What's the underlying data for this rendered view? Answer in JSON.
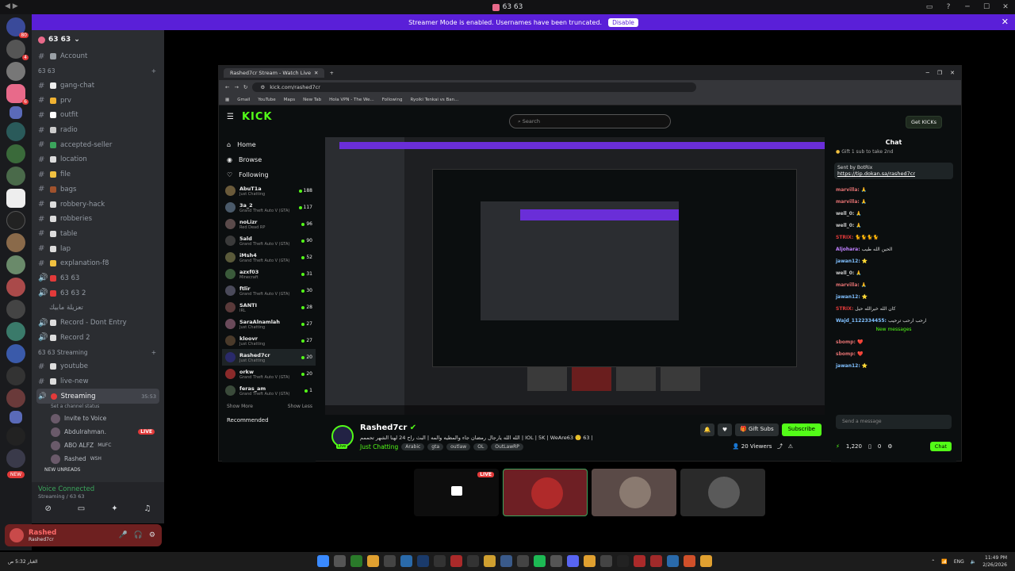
{
  "window": {
    "title": "63 63"
  },
  "banner": {
    "text": "Streamer Mode is enabled. Usernames have been truncated.",
    "button": "Disable"
  },
  "rail": {
    "badges": [
      "80",
      "4",
      "6"
    ],
    "new_label": "NEW"
  },
  "guild": {
    "name": "63 63"
  },
  "channels_top": [
    {
      "name": "Account",
      "type": "text",
      "emoji_color": "#9aa0a6"
    },
    {
      "category": "63 63"
    },
    {
      "name": "gang-chat",
      "type": "text",
      "emoji_color": "#eeeeee"
    },
    {
      "name": "prv",
      "type": "text",
      "emoji_color": "#f0b232"
    },
    {
      "name": "outfit",
      "type": "text",
      "emoji_color": "#ffffff"
    },
    {
      "name": "radio",
      "type": "text",
      "emoji_color": "#cccccc"
    },
    {
      "name": "accepted-seller",
      "type": "text",
      "emoji_color": "#3ba55c"
    },
    {
      "name": "location",
      "type": "text",
      "emoji_color": "#dddddd"
    },
    {
      "name": "file",
      "type": "text",
      "emoji_color": "#f0c040"
    },
    {
      "name": "bags",
      "type": "text",
      "emoji_color": "#a0522d"
    },
    {
      "name": "robbery-hack",
      "type": "text",
      "emoji_color": "#dddddd"
    },
    {
      "name": "robberies",
      "type": "text",
      "emoji_color": "#dddddd"
    },
    {
      "name": "table",
      "type": "text",
      "emoji_color": "#dddddd"
    },
    {
      "name": "lap",
      "type": "text",
      "emoji_color": "#dddddd"
    },
    {
      "name": "explanation-f8",
      "type": "text",
      "emoji_color": "#f0c040"
    },
    {
      "name": "63 63",
      "type": "voice",
      "emoji_color": "#e23a3a"
    },
    {
      "name": "63 63 2",
      "type": "voice",
      "emoji_color": "#e23a3a"
    },
    {
      "name": "تعزيلة مابيك",
      "type": "text-plain"
    },
    {
      "name": "Record - Dont Entry",
      "type": "voice",
      "emoji_color": "#dddddd"
    },
    {
      "name": "Record 2",
      "type": "voice",
      "emoji_color": "#dddddd"
    },
    {
      "category": "63 63 Streaming"
    },
    {
      "name": "youtube",
      "type": "text",
      "emoji_color": "#dddddd"
    },
    {
      "name": "live-new",
      "type": "text",
      "emoji_color": "#dddddd"
    }
  ],
  "active_channel": {
    "name": "Streaming",
    "time": "35:53",
    "status": "Set a channel status"
  },
  "voice_users": [
    {
      "name": "Invite to Voice",
      "live": ""
    },
    {
      "name": "Abdulrahman.",
      "live": "LIVE"
    },
    {
      "name": "ABO ALFZ",
      "live": "",
      "tag": "MUFC"
    },
    {
      "name": "Rashed",
      "live": "",
      "tag": "WSH"
    }
  ],
  "new_unreads": "NEW UNREADS",
  "voice_panel": {
    "status": "Voice Connected",
    "sub": "Streaming / 63 63"
  },
  "user_panel": {
    "name": "Rashed",
    "status": "Rashed7cr"
  },
  "browser": {
    "tab_title": "Rashed7cr Stream - Watch Live",
    "url": "kick.com/rashed7cr",
    "bookmarks": [
      "Gmail",
      "YouTube",
      "Maps",
      "New Tab",
      "Hola VPN - The We...",
      "Following",
      "Ryoiki Tenkai vs Ban..."
    ]
  },
  "kick": {
    "logo": "KICK",
    "search_placeholder": "Search",
    "get_kicks": "Get KICKs",
    "nav": [
      {
        "label": "Home",
        "icon": "home-icon"
      },
      {
        "label": "Browse",
        "icon": "browse-icon"
      },
      {
        "label": "Following",
        "icon": "heart-icon"
      }
    ],
    "channels": [
      {
        "name": "AbuT1a",
        "game": "Just Chatting",
        "viewers": "188",
        "color": "#6a5a3a"
      },
      {
        "name": "3a_2",
        "game": "Grand Theft Auto V (GTA)",
        "viewers": "117",
        "color": "#4a5a6a"
      },
      {
        "name": "noLizr",
        "game": "Red Dead RP",
        "viewers": "96",
        "color": "#5a4a4a"
      },
      {
        "name": "5ald",
        "game": "Grand Theft Auto V (GTA)",
        "viewers": "90",
        "color": "#3a3a3a"
      },
      {
        "name": "iMsh4",
        "game": "Grand Theft Auto V (GTA)",
        "viewers": "52",
        "color": "#5a5a3a"
      },
      {
        "name": "azxf03",
        "game": "Minecraft",
        "viewers": "31",
        "color": "#3a5a3a"
      },
      {
        "name": "ftlir",
        "game": "Grand Theft Auto V (GTA)",
        "viewers": "30",
        "color": "#4a4a5a"
      },
      {
        "name": "SANTI",
        "game": "IRL",
        "viewers": "28",
        "color": "#5a3a3a"
      },
      {
        "name": "SaraAlnamlah",
        "game": "Just Chatting",
        "viewers": "27",
        "color": "#6a4a5a"
      },
      {
        "name": "kloovr",
        "game": "Just Chatting",
        "viewers": "27",
        "color": "#4a3a2a"
      },
      {
        "name": "Rashed7cr",
        "game": "Just Chatting",
        "viewers": "20",
        "color": "#2a2a6a"
      },
      {
        "name": "orkw",
        "game": "Grand Theft Auto V (GTA)",
        "viewers": "20",
        "color": "#8a2a2a"
      },
      {
        "name": "feras_am",
        "game": "Grand Theft Auto V (GTA)",
        "viewers": "1",
        "color": "#3a4a3a"
      }
    ],
    "show_more": "Show More",
    "show_less": "Show Less",
    "recommended": "Recommended",
    "streamer": {
      "name": "Rashed7cr",
      "title": "الله الله يارجال رمضان جاء والمطيه والمه | البث راح 24 لهنا الشهر تحممم | IOL | 5K | WeAre63 🙂 63 |",
      "live_label": "Live",
      "category": "Just Chatting",
      "tags": [
        "Arabic",
        "gta",
        "outlaw",
        "OL",
        "OutLawRP"
      ],
      "gift_subs": "Gift Subs",
      "subscribe": "Subscribe",
      "viewers": "20 Viewers"
    },
    "chat": {
      "title": "Chat",
      "pinned_sender": "Sent by BotRix",
      "pinned_link": "https://tip.dokan.sa/rashed7cr",
      "gift_note": "Gift 1 sub to take 2nd",
      "messages": [
        {
          "user": "marvilla:",
          "text": "🙏",
          "color": "#e07070"
        },
        {
          "user": "marvilla:",
          "text": "🙏",
          "color": "#e07070"
        },
        {
          "user": "well_0:",
          "text": "🙏",
          "color": "#cccccc"
        },
        {
          "user": "well_0:",
          "text": "🙏",
          "color": "#cccccc"
        },
        {
          "user": "STRIX:",
          "text": "🐈🐈🐈🐈",
          "color": "#e23a3a"
        },
        {
          "user": "Aljohara:",
          "text": "الحين الله طيب",
          "color": "#c080ff"
        },
        {
          "user": "jawan12:",
          "text": "⭐",
          "color": "#80c0ff"
        },
        {
          "user": "well_0:",
          "text": "🙏",
          "color": "#cccccc"
        },
        {
          "user": "marvilla:",
          "text": "🙏",
          "color": "#e07070"
        },
        {
          "user": "jawan12:",
          "text": "⭐",
          "color": "#80c0ff"
        },
        {
          "user": "STRIX:",
          "text": "كان الله خيرالله حيل",
          "color": "#e23a3a"
        },
        {
          "user": "Wajd_1122334455:",
          "text": "ارحب ارحب ترحيب",
          "color": "#80c0ff"
        }
      ],
      "new_messages": "New messages",
      "messages2": [
        {
          "user": "sbomp:",
          "text": "❤️",
          "color": "#e07070"
        },
        {
          "user": "sbomp:",
          "text": "❤️",
          "color": "#e07070"
        },
        {
          "user": "jawan12:",
          "text": "⭐",
          "color": "#80c0ff"
        }
      ],
      "placeholder": "Send a message",
      "points": "1,220",
      "count": "0",
      "chat_button": "Chat"
    }
  },
  "tiles": {
    "live": "LIVE"
  },
  "taskbar": {
    "weather": "الغبار 5:32 ص",
    "lang": "ENG",
    "time": "11:49 PM",
    "date": "2/26/2026"
  }
}
